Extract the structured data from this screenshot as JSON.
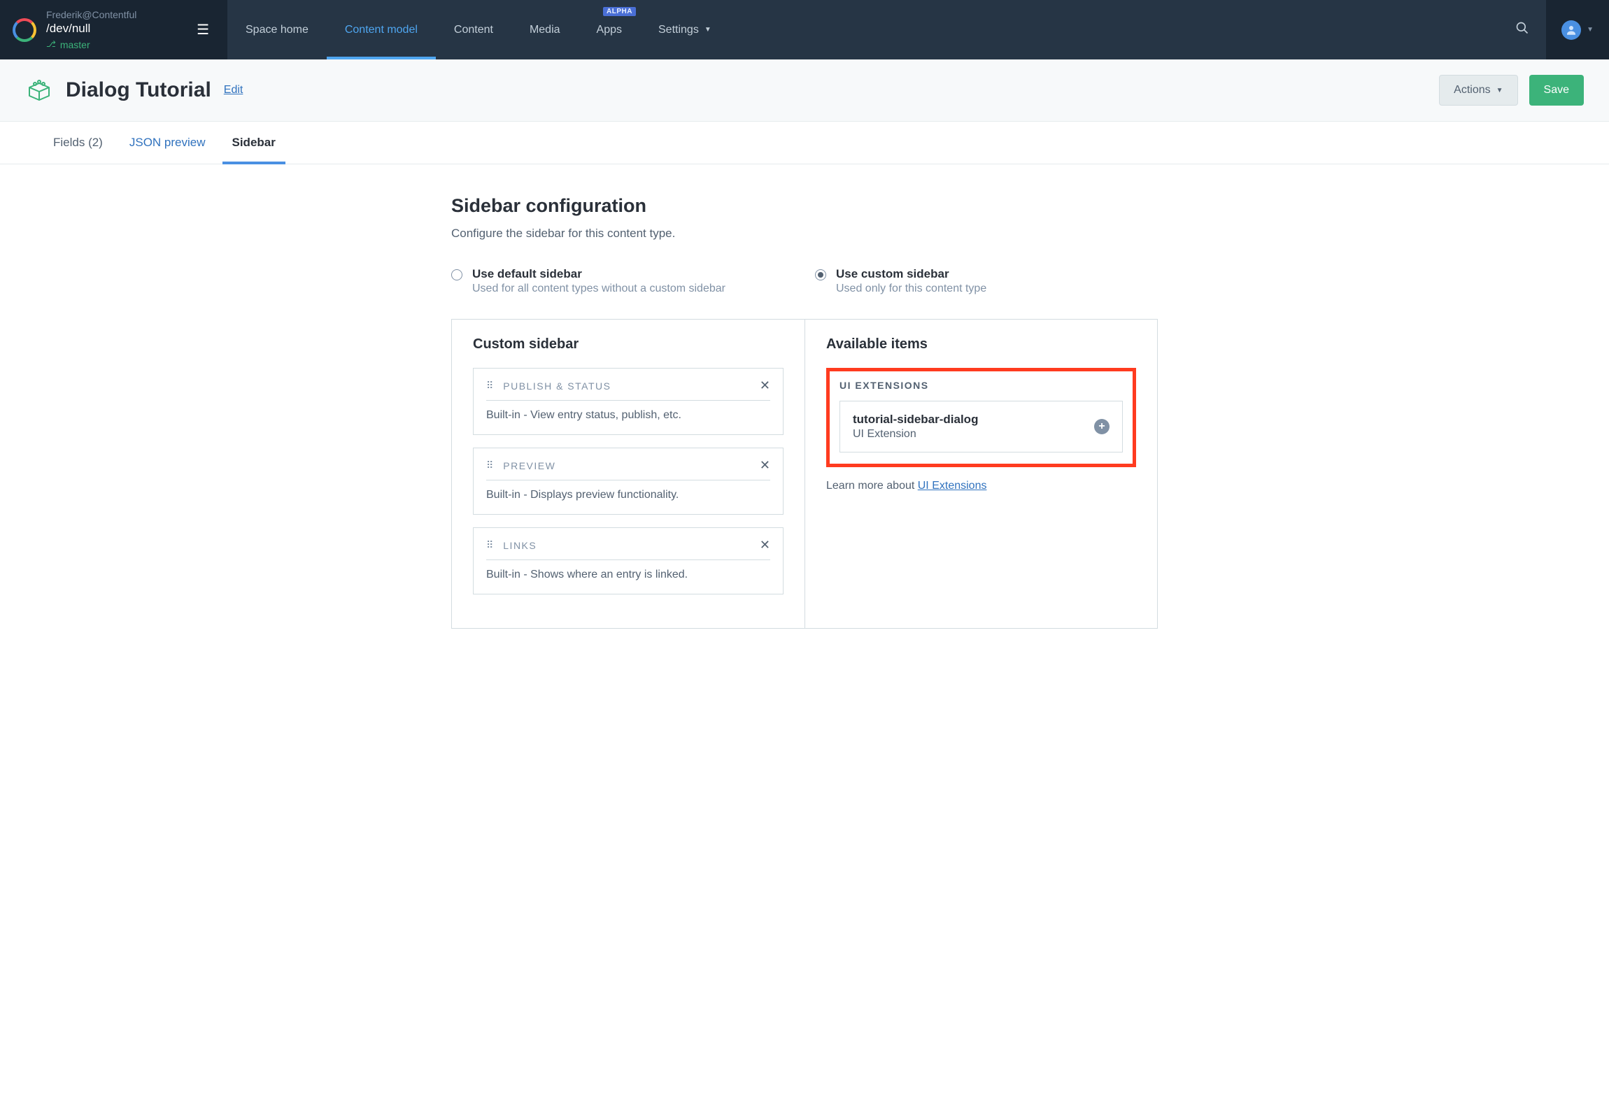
{
  "header": {
    "org": "Frederik@Contentful",
    "space": "/dev/null",
    "branch": "master",
    "nav": {
      "space_home": "Space home",
      "content_model": "Content model",
      "content": "Content",
      "media": "Media",
      "apps": "Apps",
      "apps_badge": "ALPHA",
      "settings": "Settings"
    }
  },
  "titlebar": {
    "title": "Dialog Tutorial",
    "edit": "Edit",
    "actions": "Actions",
    "save": "Save"
  },
  "tabs": {
    "fields": "Fields (2)",
    "json": "JSON preview",
    "sidebar": "Sidebar"
  },
  "section": {
    "title": "Sidebar configuration",
    "desc": "Configure the sidebar for this content type."
  },
  "radios": {
    "default": {
      "label": "Use default sidebar",
      "sub": "Used for all content types without a custom sidebar"
    },
    "custom": {
      "label": "Use custom sidebar",
      "sub": "Used only for this content type"
    }
  },
  "panels": {
    "custom_title": "Custom sidebar",
    "available_title": "Available items",
    "group_label": "UI EXTENSIONS",
    "learn_prefix": "Learn more about ",
    "learn_link": "UI Extensions"
  },
  "widgets": [
    {
      "name": "PUBLISH & STATUS",
      "desc": "Built-in - View entry status, publish, etc."
    },
    {
      "name": "PREVIEW",
      "desc": "Built-in - Displays preview functionality."
    },
    {
      "name": "LINKS",
      "desc": "Built-in - Shows where an entry is linked."
    }
  ],
  "available": [
    {
      "name": "tutorial-sidebar-dialog",
      "sub": "UI Extension"
    }
  ]
}
